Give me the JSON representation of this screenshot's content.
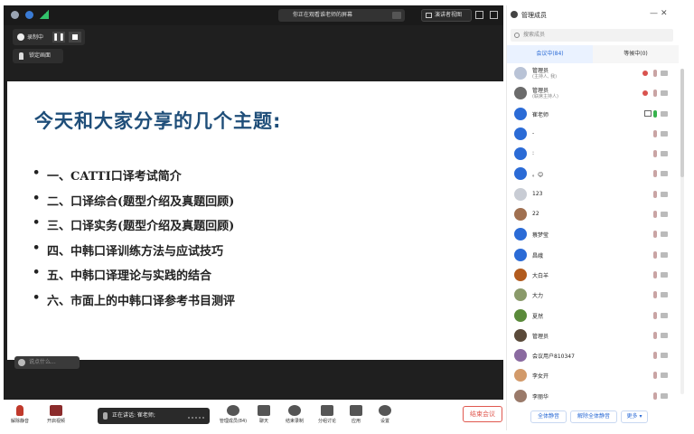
{
  "topbar": {
    "speaking_text": "你正在观看谁老师的屏幕",
    "view_label": "演讲者视图"
  },
  "recording": {
    "label": "录制中"
  },
  "lock_screen": {
    "label": "锁定画面"
  },
  "slide": {
    "title": "今天和大家分享的几个主题:",
    "bullets": [
      "一、CATTI口译考试简介",
      "二、口译综合(题型介绍及真题回顾)",
      "三、口译实务(题型介绍及真题回顾)",
      "四、中韩口译训练方法与应试技巧",
      "五、中韩口译理论与实践的结合",
      "六、市面上的中韩口译参考书目测评"
    ]
  },
  "caption_bar": {
    "label": "说点什么..."
  },
  "toolbar": {
    "mute_label": "解除静音",
    "video_label": "开启视频",
    "speaker_text": "正在讲话: 崔老师;",
    "manage_label": "管理成员(84)",
    "chat_label": "聊天",
    "record_label": "结束录制",
    "breakout_label": "分组讨论",
    "apps_label": "应用",
    "settings_label": "设置",
    "end_label": "结束会议"
  },
  "panel": {
    "title": "管理成员",
    "search_placeholder": "搜索成员",
    "tabs": [
      "会议中(84)",
      "等候中(0)"
    ],
    "members": [
      {
        "name": "管理员",
        "role": "(主持人, 我)",
        "avatar_color": "#b9c3d6",
        "mic": "muted",
        "rec": true
      },
      {
        "name": "管理员",
        "role": "(联席主持人)",
        "avatar_color": "#6b6b6b",
        "mic": "muted",
        "rec": true
      },
      {
        "name": "崔老师",
        "role": "",
        "avatar_color": "#2b6bd6",
        "mic": "on",
        "share": true
      },
      {
        "name": "-",
        "role": "",
        "avatar_color": "#2b6bd6",
        "mic": "muted"
      },
      {
        "name": ":",
        "role": "",
        "avatar_color": "#2b6bd6",
        "mic": "muted"
      },
      {
        "name": "。😊",
        "role": "",
        "avatar_color": "#2b6bd6",
        "mic": "muted"
      },
      {
        "name": "123",
        "role": "",
        "avatar_color": "#c8ccd4",
        "mic": "muted"
      },
      {
        "name": "22",
        "role": "",
        "avatar_color": "#a07050",
        "mic": "muted"
      },
      {
        "name": "蔡梦莹",
        "role": "",
        "avatar_color": "#2b6bd6",
        "mic": "muted"
      },
      {
        "name": "昌峨",
        "role": "",
        "avatar_color": "#2b6bd6",
        "mic": "muted"
      },
      {
        "name": "大白羊",
        "role": "",
        "avatar_color": "#b25b1e",
        "mic": "muted"
      },
      {
        "name": "大力",
        "role": "",
        "avatar_color": "#8a9a6a",
        "mic": "muted"
      },
      {
        "name": "夏然",
        "role": "",
        "avatar_color": "#5a8a3a",
        "mic": "muted"
      },
      {
        "name": "管理员",
        "role": "",
        "avatar_color": "#5a4a3a",
        "mic": "muted"
      },
      {
        "name": "会议用户810347",
        "role": "",
        "avatar_color": "#8a6aa0",
        "mic": "muted"
      },
      {
        "name": "李女开",
        "role": "",
        "avatar_color": "#d29a6a",
        "mic": "muted"
      },
      {
        "name": "李丽华",
        "role": "",
        "avatar_color": "#9a7a6a",
        "mic": "muted"
      }
    ],
    "footer": {
      "mute_all": "全体静音",
      "unmute_all": "解除全体静音",
      "more": "更多 ▾"
    }
  }
}
